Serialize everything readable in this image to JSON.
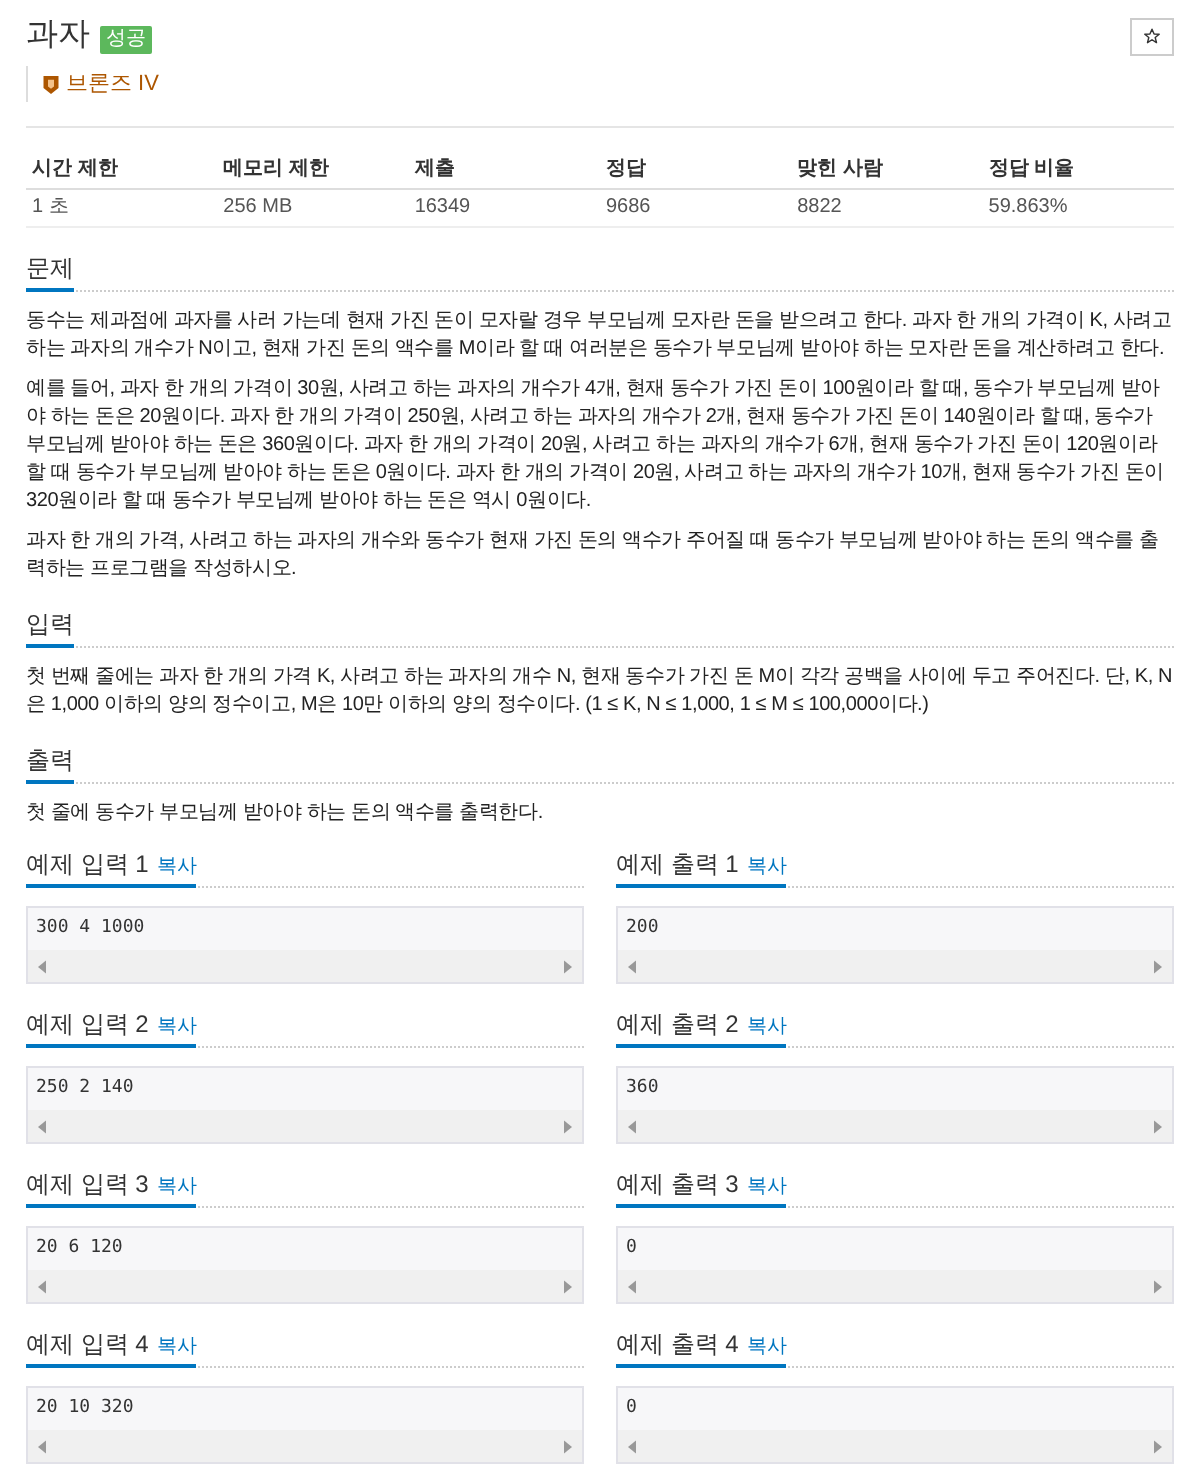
{
  "problem": {
    "title": "과자",
    "result_badge": "성공",
    "tier": "브론즈 IV"
  },
  "info_table": {
    "columns": [
      "시간 제한",
      "메모리 제한",
      "제출",
      "정답",
      "맞힌 사람",
      "정답 비율"
    ],
    "rows": [
      [
        "1 초",
        "256 MB",
        "16349",
        "9686",
        "8822",
        "59.863%"
      ]
    ]
  },
  "sections": [
    {
      "heading": "문제",
      "paragraphs": [
        "동수는 제과점에 과자를 사러 가는데 현재 가진 돈이 모자랄 경우 부모님께 모자란 돈을 받으려고 한다. 과자 한 개의 가격이 K, 사려고 하는 과자의 개수가 N이고, 현재 가진 돈의 액수를 M이라 할 때 여러분은 동수가 부모님께 받아야 하는 모자란 돈을 계산하려고 한다.",
        "예를 들어, 과자 한 개의 가격이 30원, 사려고 하는 과자의 개수가 4개, 현재 동수가 가진 돈이 100원이라 할 때, 동수가 부모님께 받아야 하는 돈은 20원이다. 과자 한 개의 가격이 250원, 사려고 하는 과자의 개수가 2개, 현재 동수가 가진 돈이 140원이라 할 때, 동수가 부모님께 받아야 하는 돈은 360원이다. 과자 한 개의 가격이 20원, 사려고 하는 과자의 개수가 6개, 현재 동수가 가진 돈이 120원이라 할 때 동수가 부모님께 받아야 하는 돈은 0원이다. 과자 한 개의 가격이 20원, 사려고 하는 과자의 개수가 10개, 현재 동수가 가진 돈이 320원이라 할 때 동수가 부모님께 받아야 하는 돈은 역시 0원이다.",
        "과자 한 개의 가격, 사려고 하는 과자의 개수와 동수가 현재 가진 돈의 액수가 주어질 때 동수가 부모님께 받아야 하는 돈의 액수를 출력하는 프로그램을 작성하시오."
      ]
    },
    {
      "heading": "입력",
      "paragraphs": [
        "첫 번째 줄에는 과자 한 개의 가격 K, 사려고 하는 과자의 개수 N, 현재 동수가 가진 돈 M이 각각 공백을 사이에 두고 주어진다. 단, K, N은 1,000 이하의 양의 정수이고, M은 10만 이하의 양의 정수이다. (1 ≤ K, N ≤ 1,000, 1 ≤ M ≤ 100,000이다.)"
      ]
    },
    {
      "heading": "출력",
      "paragraphs": [
        "첫 줄에 동수가 부모님께 받아야 하는 돈의 액수를 출력한다."
      ]
    }
  ],
  "samples": [
    {
      "input": {
        "heading": "예제 입력 1",
        "copy_link": "복사",
        "text": "300 4 1000"
      },
      "output": {
        "heading": "예제 출력 1",
        "copy_link": "복사",
        "text": "200"
      }
    },
    {
      "input": {
        "heading": "예제 입력 2",
        "copy_link": "복사",
        "text": "250 2 140"
      },
      "output": {
        "heading": "예제 출력 2",
        "copy_link": "복사",
        "text": "360"
      }
    },
    {
      "input": {
        "heading": "예제 입력 3",
        "copy_link": "복사",
        "text": "20 6 120"
      },
      "output": {
        "heading": "예제 출력 3",
        "copy_link": "복사",
        "text": "0"
      }
    },
    {
      "input": {
        "heading": "예제 입력 4",
        "copy_link": "복사",
        "text": "20 10 320"
      },
      "output": {
        "heading": "예제 출력 4",
        "copy_link": "복사",
        "text": "0"
      }
    }
  ]
}
